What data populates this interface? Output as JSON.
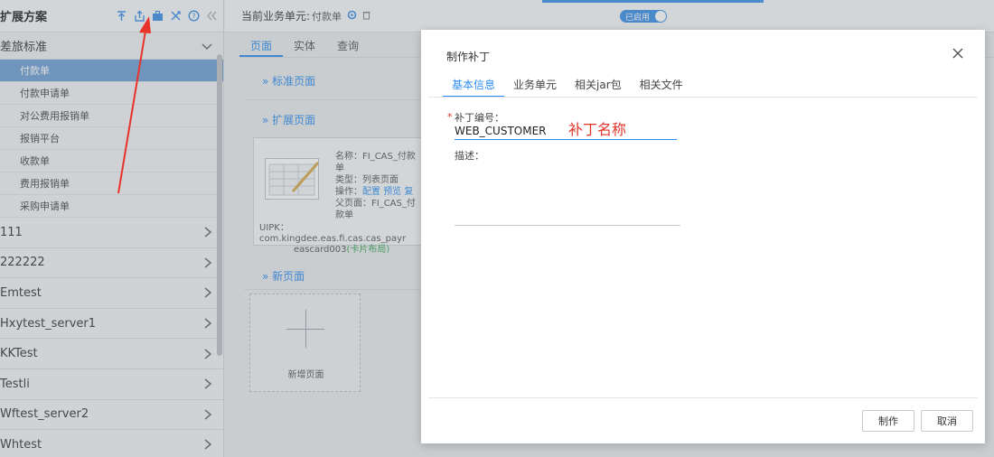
{
  "sidebar": {
    "title": "扩展方案",
    "tools": [
      "to-top-icon",
      "upload-icon",
      "briefcase-icon",
      "shuffle-icon",
      "help-icon",
      "collapse-icon"
    ],
    "group": {
      "label": "差旅标准"
    },
    "sub_items": [
      {
        "label": "付款单",
        "active": true
      },
      {
        "label": "付款申请单"
      },
      {
        "label": "对公费用报销单"
      },
      {
        "label": "报销平台"
      },
      {
        "label": "收款单"
      },
      {
        "label": "费用报销单"
      },
      {
        "label": "采购申请单"
      }
    ],
    "categories": [
      "111",
      "222222",
      "Emtest",
      "Hxytest_server1",
      "KKTest",
      "Testli",
      "Wftest_server2",
      "Whtest"
    ]
  },
  "topbar": {
    "business_unit_label": "当前业务单元:",
    "business_unit_value": "付款单",
    "toggle_label": "已启用"
  },
  "main": {
    "tabs": [
      "页面",
      "实体",
      "查询"
    ],
    "sections": {
      "standard": "标准页面",
      "extended": "扩展页面",
      "new": "新页面"
    },
    "card": {
      "name": "名称：FI_CAS_付款单",
      "type": "类型：列表页面",
      "ops_prefix": "操作：",
      "op_config": "配置",
      "op_preview": "预览",
      "op_more": "复",
      "parent": "父页面：FI_CAS_付款单",
      "uipk_label": "UIPK：",
      "uipk_value": "com.kingdee.eas.fi.cas.cas_payr",
      "uipk_value2": "eascard003",
      "uipk_tag": "(卡片布局)"
    },
    "new_page_label": "新增页面"
  },
  "dialog": {
    "title": "制作补丁",
    "tabs": [
      "基本信息",
      "业务单元",
      "相关jar包",
      "相关文件"
    ],
    "patch_no_label": "补丁编号：",
    "patch_no_value": "WEB_CUSTOMER",
    "annotation": "补丁名称",
    "desc_label": "描述：",
    "make_button": "制作",
    "cancel_button": "取消"
  },
  "colors": {
    "accent": "#2d8cf0",
    "active_item": "#6e9fd3",
    "required": "#e0352b"
  }
}
